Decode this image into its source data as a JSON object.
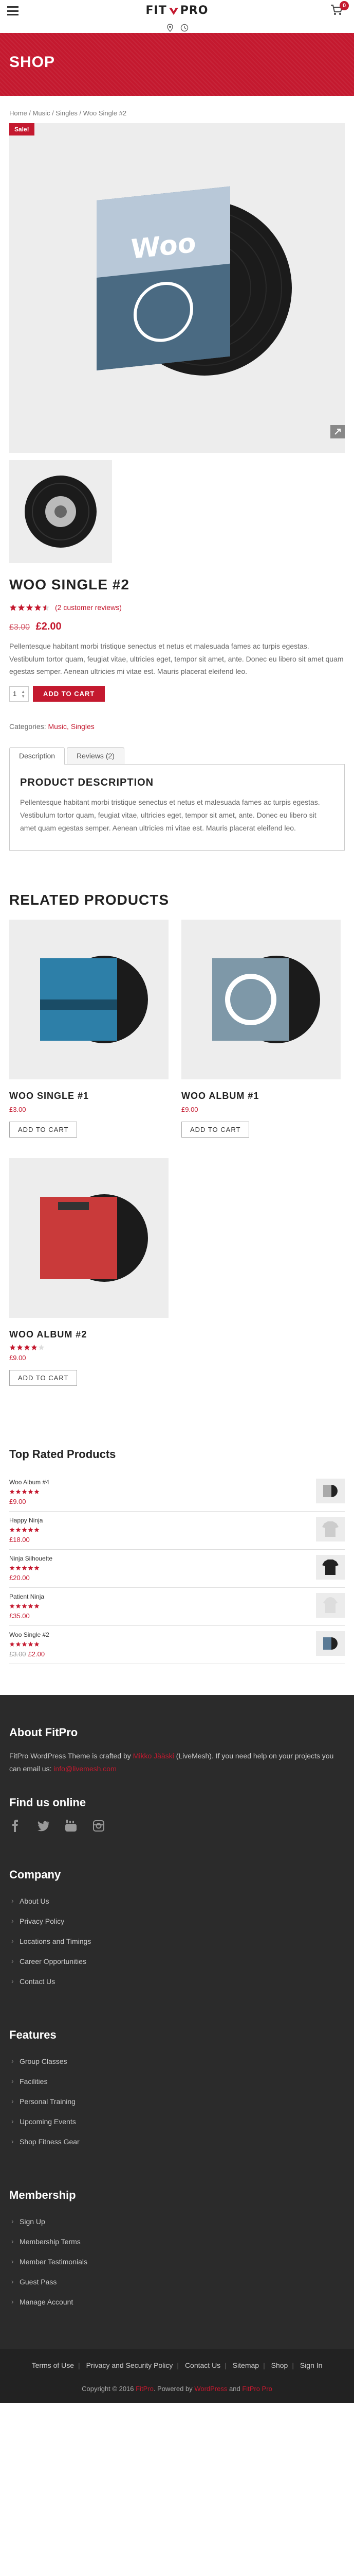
{
  "header": {
    "logo_left": "FIT",
    "logo_right": "PRO",
    "cart_count": "0"
  },
  "banner": {
    "title": "SHOP"
  },
  "breadcrumb": "Home / Music / Singles / Woo Single #2",
  "product": {
    "sale_badge": "Sale!",
    "title": "WOO SINGLE #2",
    "rating": 4.5,
    "reviews_link": "(2 customer reviews)",
    "old_price": "£3.00",
    "new_price": "£2.00",
    "description": "Pellentesque habitant morbi tristique senectus et netus et malesuada fames ac turpis egestas. Vestibulum tortor quam, feugiat vitae, ultricies eget, tempor sit amet, ante. Donec eu libero sit amet quam egestas semper. Aenean ultricies mi vitae est. Mauris placerat eleifend leo.",
    "quantity": "1",
    "add_to_cart": "ADD TO CART",
    "categories_label": "Categories:",
    "categories": "Music, Singles",
    "record_label": "Woo"
  },
  "tabs": {
    "description": "Description",
    "reviews": "Reviews (2)",
    "panel_title": "PRODUCT DESCRIPTION",
    "panel_text": "Pellentesque habitant morbi tristique senectus et netus et malesuada fames ac turpis egestas. Vestibulum tortor quam, feugiat vitae, ultricies eget, tempor sit amet, ante. Donec eu libero sit amet quam egestas semper. Aenean ultricies mi vitae est. Mauris placerat eleifend leo."
  },
  "related": {
    "title": "RELATED PRODUCTS",
    "items": [
      {
        "name": "WOO SINGLE #1",
        "price": "£3.00",
        "button": "ADD TO CART"
      },
      {
        "name": "WOO ALBUM #1",
        "price": "£9.00",
        "button": "ADD TO CART"
      },
      {
        "name": "WOO ALBUM #2",
        "price": "£9.00",
        "button": "ADD TO CART",
        "rating": 4
      }
    ]
  },
  "top_rated": {
    "title": "Top Rated Products",
    "items": [
      {
        "name": "Woo Album #4",
        "price": "£9.00"
      },
      {
        "name": "Happy Ninja",
        "price": "£18.00"
      },
      {
        "name": "Ninja Silhouette",
        "price": "£20.00"
      },
      {
        "name": "Patient Ninja",
        "price": "£35.00"
      },
      {
        "name": "Woo Single #2",
        "old_price": "£3.00",
        "price": "£2.00"
      }
    ]
  },
  "footer": {
    "about_title": "About FitPro",
    "about_text_1": "FitPro WordPress Theme is crafted by",
    "about_link_1": "Mikko Jääski",
    "about_text_2": "(LiveMesh). If you need help on your projects you can email us:",
    "about_link_2": "info@livemesh.com",
    "find_us": "Find us online",
    "company_title": "Company",
    "company": [
      "About Us",
      "Privacy Policy",
      "Locations and Timings",
      "Career Opportunities",
      "Contact Us"
    ],
    "features_title": "Features",
    "features": [
      "Group Classes",
      "Facilities",
      "Personal Training",
      "Upcoming Events",
      "Shop Fitness Gear"
    ],
    "membership_title": "Membership",
    "membership": [
      "Sign Up",
      "Membership Terms",
      "Member Testimonials",
      "Guest Pass",
      "Manage Account"
    ],
    "bottom_links": [
      "Terms of Use",
      "Privacy and Security Policy",
      "Contact Us",
      "Sitemap",
      "Shop",
      "Sign In"
    ],
    "copyright_1": "Copyright © 2016",
    "copyright_brand": "FitPro",
    "copyright_2": ". Powered by",
    "copyright_wp": "WordPress",
    "copyright_3": "and",
    "copyright_theme": "FitPro Pro"
  }
}
